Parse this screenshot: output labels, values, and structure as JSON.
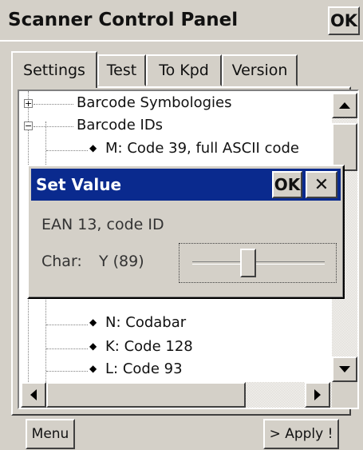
{
  "window": {
    "title": "Scanner Control Panel",
    "ok_label": "OK"
  },
  "tabs": [
    {
      "label": "Settings",
      "selected": true
    },
    {
      "label": "Test",
      "selected": false
    },
    {
      "label": "To Kpd",
      "selected": false
    },
    {
      "label": "Version",
      "selected": false
    }
  ],
  "tree": {
    "items": [
      {
        "label": "Barcode Symbologies",
        "expander": "+"
      },
      {
        "label": "Barcode IDs",
        "expander": "−"
      },
      {
        "label": "M: Code 39, full ASCII code"
      },
      {
        "label": "N: Codabar"
      },
      {
        "label": "K: Code 128"
      },
      {
        "label": "L: Code 93"
      }
    ]
  },
  "dialog": {
    "title": "Set Value",
    "ok_label": "OK",
    "close_label": "✕",
    "field_label": "EAN 13, code ID",
    "char_label": "Char:",
    "char_value": "Y (89)",
    "slider_fraction": 0.42
  },
  "bottom": {
    "menu_label": "Menu",
    "apply_label": "> Apply !"
  },
  "colors": {
    "dialog_title_bg": "#0a2a8e",
    "face": "#d4d0c8"
  }
}
